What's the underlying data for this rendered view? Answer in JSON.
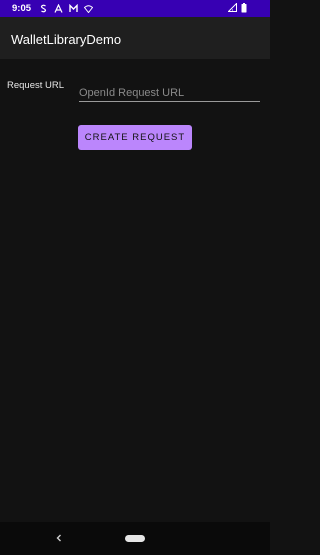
{
  "status_bar": {
    "time": "9:05",
    "color": "#3700b3",
    "left_icons": [
      "notification-s-icon",
      "notification-a-icon",
      "gmail-icon",
      "wifi-question-icon"
    ],
    "right_icons": [
      "signal-icon",
      "battery-icon"
    ]
  },
  "app_bar": {
    "title": "WalletLibraryDemo"
  },
  "form": {
    "url_label": "Request URL",
    "url_value": "",
    "url_placeholder": "OpenId Request URL",
    "create_button_label": "CREATE REQUEST",
    "accent_color": "#bb86fc"
  },
  "nav_bar": {
    "back_icon": "back-chevron-icon",
    "home_icon": "home-pill-icon"
  }
}
